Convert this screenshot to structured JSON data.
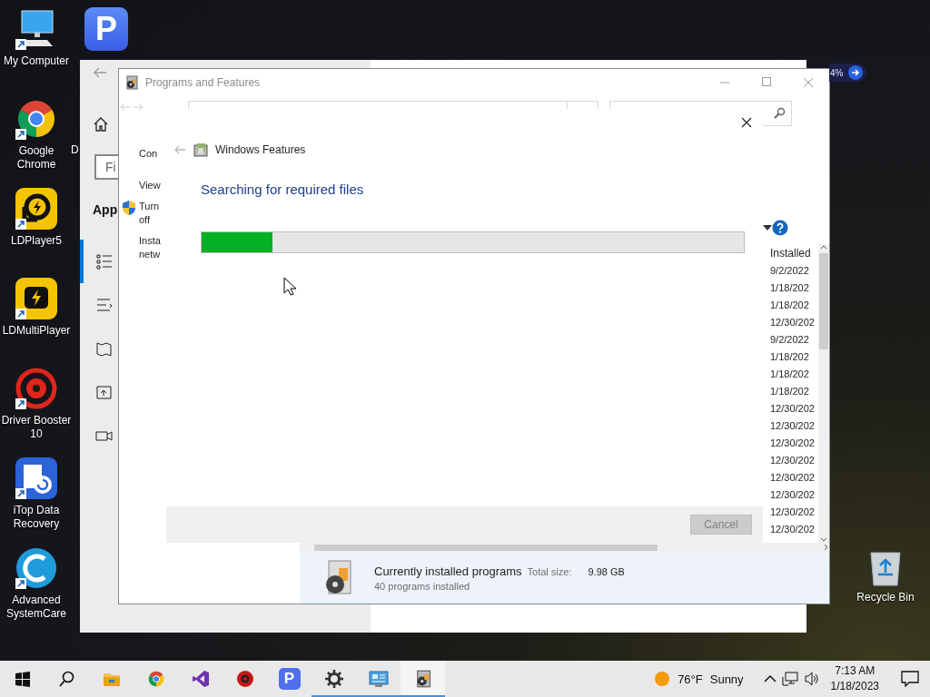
{
  "desktop_icons": [
    {
      "label": "My Computer",
      "kind": "computer"
    },
    {
      "label": "Google Chrome",
      "kind": "chrome"
    },
    {
      "label": "LDPlayer5",
      "kind": "ldplayer"
    },
    {
      "label": "LDMultiPlayer",
      "kind": "ldmulti"
    },
    {
      "label": "Driver Booster 10",
      "kind": "driver-booster"
    },
    {
      "label": "iTop Data Recovery",
      "kind": "data-recovery"
    },
    {
      "label": "Advanced SystemCare",
      "kind": "systemcare"
    }
  ],
  "pdf_shortcut": {
    "logo": "P"
  },
  "covered_label": "D",
  "recycle_bin": {
    "label": "Recycle Bin"
  },
  "percent_widget": {
    "text": "4%"
  },
  "settings_window": {
    "search_fragment": "Fi",
    "heading_fragment": "App",
    "nav_items": [
      {
        "kind": "list",
        "selected": true
      },
      {
        "kind": "list-alt",
        "selected": false
      },
      {
        "kind": "map",
        "selected": false
      },
      {
        "kind": "upload",
        "selected": false
      },
      {
        "kind": "video",
        "selected": false
      }
    ]
  },
  "programs_window": {
    "title": "Programs and Features",
    "left_links": [
      {
        "lines": [
          "Con"
        ],
        "shield": false
      },
      {
        "lines": [
          "View"
        ],
        "shield": false
      },
      {
        "lines": [
          "Turn",
          "off"
        ],
        "shield": true
      },
      {
        "lines": [
          "Insta",
          "netw"
        ],
        "shield": false
      }
    ],
    "installed_column": {
      "header": "Installed",
      "rows": [
        "9/2/2022",
        "1/18/202",
        "1/18/202",
        "12/30/202",
        "9/2/2022",
        "1/18/202",
        "1/18/202",
        "1/18/202",
        "12/30/202",
        "12/30/202",
        "12/30/202",
        "12/30/202",
        "12/30/202",
        "12/30/202",
        "12/30/202",
        "12/30/202"
      ]
    },
    "details": {
      "title": "Currently installed programs",
      "size_label": "Total size:",
      "size_value": "9.98 GB",
      "count": "40 programs installed"
    }
  },
  "dialog": {
    "title": "Windows Features",
    "heading": "Searching for required files",
    "progress": {
      "level": 0.13
    },
    "cancel": {
      "label": "Cancel",
      "disabled": true
    }
  },
  "taskbar": {
    "buttons": [
      {
        "kind": "start",
        "running": false,
        "active": false
      },
      {
        "kind": "search",
        "running": false,
        "active": false
      },
      {
        "kind": "explorer",
        "running": false,
        "active": false
      },
      {
        "kind": "chrome",
        "running": false,
        "active": false
      },
      {
        "kind": "visual-studio",
        "running": false,
        "active": false
      },
      {
        "kind": "driver-booster",
        "running": false,
        "active": false
      },
      {
        "kind": "pdf",
        "logo": "P",
        "running": false,
        "active": false
      },
      {
        "kind": "settings",
        "running": true,
        "active": false
      },
      {
        "kind": "control-panel",
        "running": true,
        "active": false
      },
      {
        "kind": "programs",
        "running": true,
        "active": true
      }
    ],
    "weather": {
      "temperature": "76°F",
      "condition": "Sunny"
    },
    "clock": {
      "time": "7:13 AM",
      "date": "1/18/2023"
    }
  }
}
